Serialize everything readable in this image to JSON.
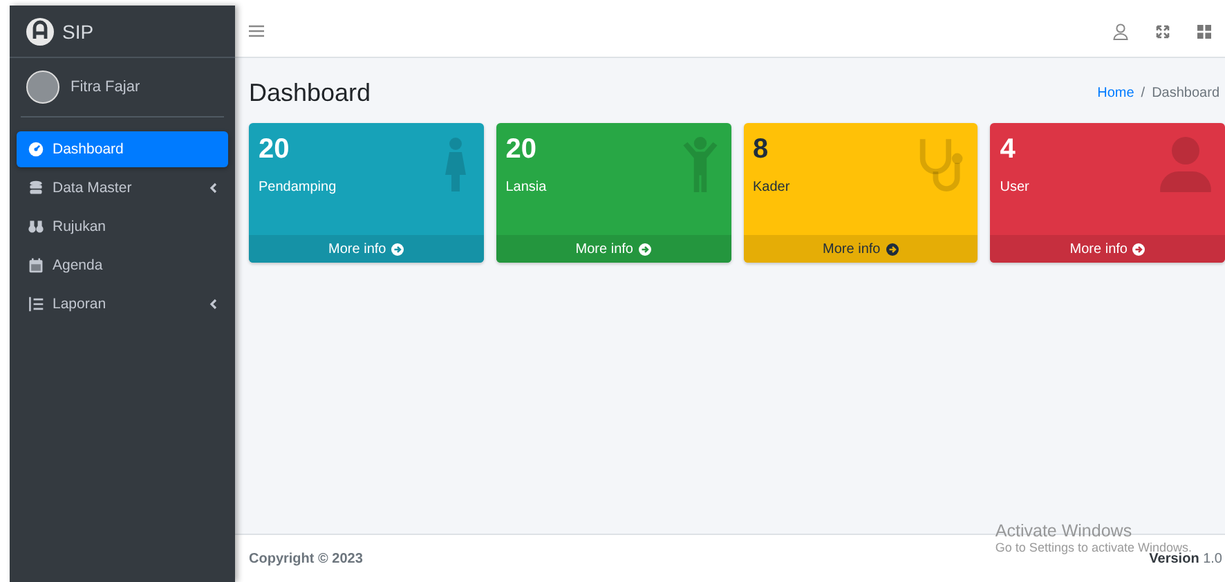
{
  "brand": {
    "name": "SIP"
  },
  "user": {
    "name": "Fitra Fajar"
  },
  "menu": [
    {
      "label": "Dashboard",
      "selected": true,
      "expandable": false
    },
    {
      "label": "Data Master",
      "selected": false,
      "expandable": true
    },
    {
      "label": "Rujukan",
      "selected": false,
      "expandable": false
    },
    {
      "label": "Agenda",
      "selected": false,
      "expandable": false
    },
    {
      "label": "Laporan",
      "selected": false,
      "expandable": true
    }
  ],
  "page_title": "Dashboard",
  "breadcrumb": {
    "separator": "/",
    "items": [
      {
        "label": "Home",
        "kind": "link"
      },
      {
        "label": "Dashboard",
        "kind": "current"
      }
    ]
  },
  "cards": [
    {
      "kind": "info",
      "count": "20",
      "label": "Pendamping",
      "link": "More info"
    },
    {
      "kind": "success",
      "count": "20",
      "label": "Lansia",
      "link": "More info"
    },
    {
      "kind": "warning",
      "count": "8",
      "label": "Kader",
      "link": "More info"
    },
    {
      "kind": "danger",
      "count": "4",
      "label": "User",
      "link": "More info"
    }
  ],
  "footer": {
    "copyright": "Copyright © 2023",
    "version": "**Version** 1.0"
  },
  "os_overlay": {
    "title": "Activate Windows",
    "subtitle": "Go to Settings to activate Windows."
  }
}
